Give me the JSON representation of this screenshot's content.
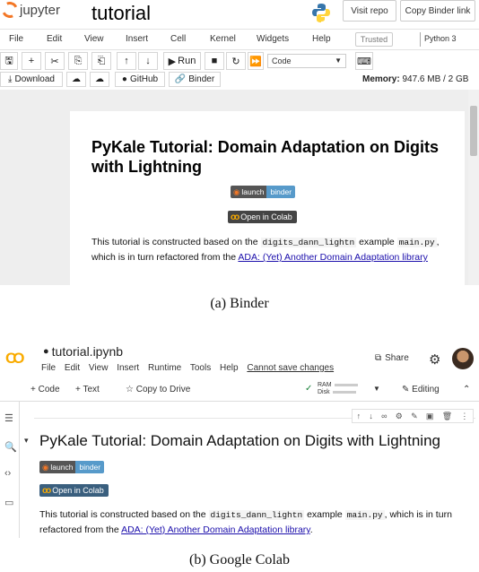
{
  "jupyter": {
    "logo_text": "jupyter",
    "notebook_title": "tutorial",
    "visit_repo": "Visit repo",
    "copy_binder_link": "Copy Binder link",
    "menu": [
      "File",
      "Edit",
      "View",
      "Insert",
      "Cell",
      "Kernel",
      "Widgets",
      "Help"
    ],
    "trusted": "Trusted",
    "kernel": "Python 3",
    "run_label": "Run",
    "cell_type": "Code",
    "download": "Download",
    "github": "GitHub",
    "binder": "Binder",
    "memory_label": "Memory:",
    "memory_value": "947.6 MB / 2 GB",
    "heading": "PyKale Tutorial: Domain Adaptation on Digits with Lightning",
    "badge_left": "launch",
    "badge_right": "binder",
    "colab_badge": "Open in Colab",
    "para_1": "This tutorial is constructed based on the",
    "para_code_1": "digits_dann_lightn",
    "para_2": "example",
    "para_code_2": "main.py",
    "para_3": ", which is in turn refactored from the",
    "para_link": "ADA: (Yet) Another Domain Adaptation library"
  },
  "captions": {
    "a": "(a)  Binder",
    "b": "(b)  Google Colab"
  },
  "colab": {
    "logo": "CO",
    "title": "tutorial.ipynb",
    "menu": [
      "File",
      "Edit",
      "View",
      "Insert",
      "Runtime",
      "Tools",
      "Help"
    ],
    "cannot_save": "Cannot save changes",
    "share": "Share",
    "add_code": "+ Code",
    "add_text": "+ Text",
    "copy_drive": "Copy to Drive",
    "ram": "RAM",
    "disk": "Disk",
    "editing": "Editing",
    "heading": "PyKale Tutorial: Domain Adaptation on Digits with Lightning",
    "badge_left": "launch",
    "badge_right": "binder",
    "colab_badge": "Open in Colab",
    "para_1": "This tutorial is constructed based on the",
    "para_code_1": "digits_dann_lightn",
    "para_2": "example",
    "para_code_2": "main.py",
    "para_3": ", which is in turn",
    "para_4": "refactored from the",
    "para_link": "ADA: (Yet) Another Domain Adaptation library",
    "para_end": "."
  }
}
